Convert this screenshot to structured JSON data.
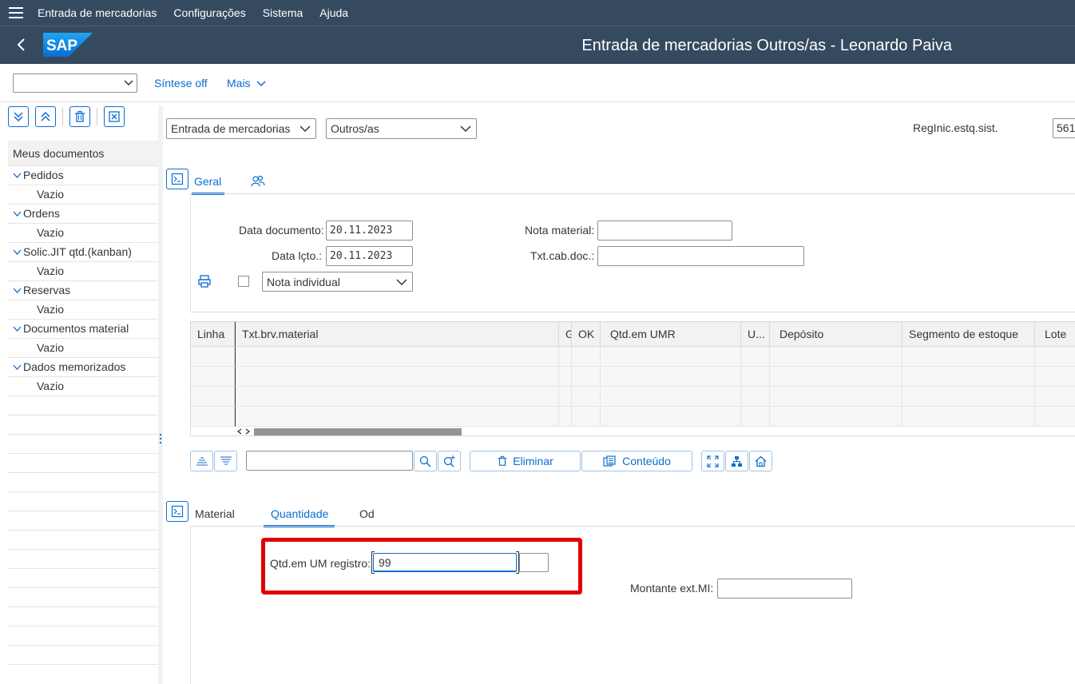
{
  "menu": {
    "items": [
      "Entrada de mercadorias",
      "Configurações",
      "Sistema",
      "Ajuda"
    ]
  },
  "header": {
    "logo_text": "SAP",
    "title": "Entrada de mercadorias Outros/as - Leonardo Paiva"
  },
  "toolbar": {
    "dropdown_value": "",
    "sintese": "Síntese off",
    "mais": "Mais"
  },
  "sidebar": {
    "heading": "Meus documentos",
    "items": [
      {
        "label": "Pedidos",
        "child": "Vazio"
      },
      {
        "label": "Ordens",
        "child": "Vazio"
      },
      {
        "label": "Solic.JIT qtd.(kanban)",
        "child": "Vazio"
      },
      {
        "label": "Reservas",
        "child": "Vazio"
      },
      {
        "label": "Documentos material",
        "child": "Vazio"
      },
      {
        "label": "Dados memorizados",
        "child": "Vazio"
      }
    ]
  },
  "header_form": {
    "transaction": "Entrada de mercadorias",
    "reference": "Outros/as",
    "reg_label": "RegInic.estq.sist.",
    "reg_value": "561"
  },
  "tabs_top": {
    "geral": "Geral"
  },
  "geral": {
    "data_doc_label": "Data documento:",
    "data_doc_value": "20.11.2023",
    "data_lcto_label": "Data lçto.:",
    "data_lcto_value": "20.11.2023",
    "nota_material_label": "Nota material:",
    "nota_material_value": "",
    "txt_cab_label": "Txt.cab.doc.:",
    "txt_cab_value": "",
    "nota_select": "Nota individual"
  },
  "table": {
    "headers": [
      "Linha",
      "Txt.brv.material",
      "G",
      "OK",
      "Qtd.em UMR",
      "U...",
      "Depósito",
      "Segmento de estoque",
      "Lote"
    ]
  },
  "table_toolbar": {
    "search_value": "",
    "eliminar": "Eliminar",
    "conteudo": "Conteúdo"
  },
  "tabs_bottom": {
    "material": "Material",
    "quantidade": "Quantidade",
    "od": "Od"
  },
  "quantidade": {
    "qtd_label": "Qtd.em UM registro:",
    "qtd_value": "99",
    "unit_value": "",
    "montante_label": "Montante ext.MI:",
    "montante_value": ""
  }
}
